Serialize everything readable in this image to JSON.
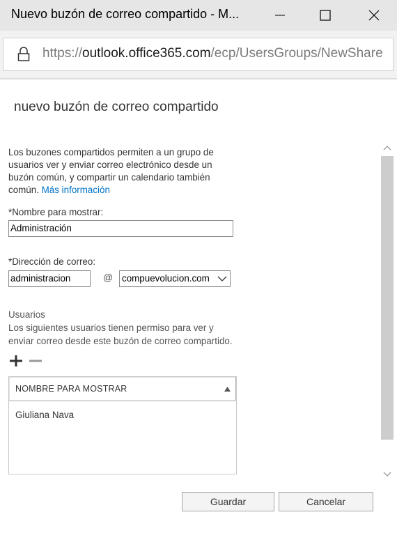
{
  "window": {
    "title": "Nuevo buzón de correo compartido - M...",
    "minimize_icon": "minimize-icon",
    "maximize_icon": "maximize-icon",
    "close_icon": "close-icon"
  },
  "address_bar": {
    "scheme": "https://",
    "host": "outlook.office365.com",
    "path": "/ecp/UsersGroups/NewShare",
    "icon": "lock-icon"
  },
  "form": {
    "heading": "nuevo buzón de correo compartido",
    "description": "Los buzones compartidos permiten a un grupo de usuarios ver y enviar correo electrónico desde un buzón común, y compartir un calendario también común.",
    "more_info_link": "Más información",
    "display_name_label": "*Nombre para mostrar:",
    "display_name_value": "Administración",
    "email_label": "*Dirección de correo:",
    "email_value": "administracion",
    "at_sign": "@",
    "domain_value": "compuevolucion.com",
    "users_heading": "Usuarios",
    "users_description": "Los siguientes usuarios tienen permiso para ver y enviar correo desde este buzón de correo compartido.",
    "add_icon": "plus-icon",
    "remove_icon": "minus-icon",
    "grid_header": "NOMBRE PARA MOSTRAR",
    "users": [
      "Giuliana Nava"
    ]
  },
  "buttons": {
    "save": "Guardar",
    "cancel": "Cancelar"
  },
  "colors": {
    "link": "#0072c6",
    "titlebar": "#e6e6e6"
  }
}
